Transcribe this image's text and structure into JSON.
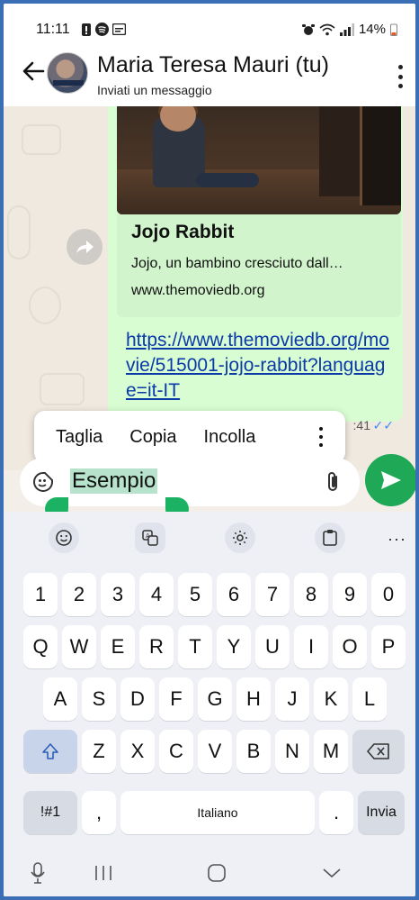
{
  "status_bar": {
    "time": "11:11",
    "battery": "14%"
  },
  "header": {
    "contact_name": "Maria Teresa Mauri (tu)",
    "subtitle": "Inviati un messaggio"
  },
  "message": {
    "link_title": "Jojo Rabbit",
    "link_description": "Jojo, un bambino cresciuto dall…",
    "link_domain": "www.themoviedb.org",
    "url": "https://www.themoviedb.org/movie/515001-jojo-rabbit?language=it-IT",
    "time_partial": ":41",
    "ticks": "✓✓"
  },
  "text_menu": {
    "items": [
      "Taglia",
      "Copia",
      "Incolla"
    ]
  },
  "composer": {
    "text": "Esempio"
  },
  "keyboard": {
    "numbers": [
      "1",
      "2",
      "3",
      "4",
      "5",
      "6",
      "7",
      "8",
      "9",
      "0"
    ],
    "row_q": [
      "Q",
      "W",
      "E",
      "R",
      "T",
      "Y",
      "U",
      "I",
      "O",
      "P"
    ],
    "row_a": [
      "A",
      "S",
      "D",
      "F",
      "G",
      "H",
      "J",
      "K",
      "L"
    ],
    "row_z": [
      "Z",
      "X",
      "C",
      "V",
      "B",
      "N",
      "M"
    ],
    "symbols_key": "!#1",
    "comma_key": ",",
    "space_label": "Italiano",
    "period_key": ".",
    "enter_label": "Invia",
    "more": "···"
  },
  "colors": {
    "accent": "#1fa855",
    "bubble": "#d9fdd3",
    "link": "#0b3aa8"
  }
}
